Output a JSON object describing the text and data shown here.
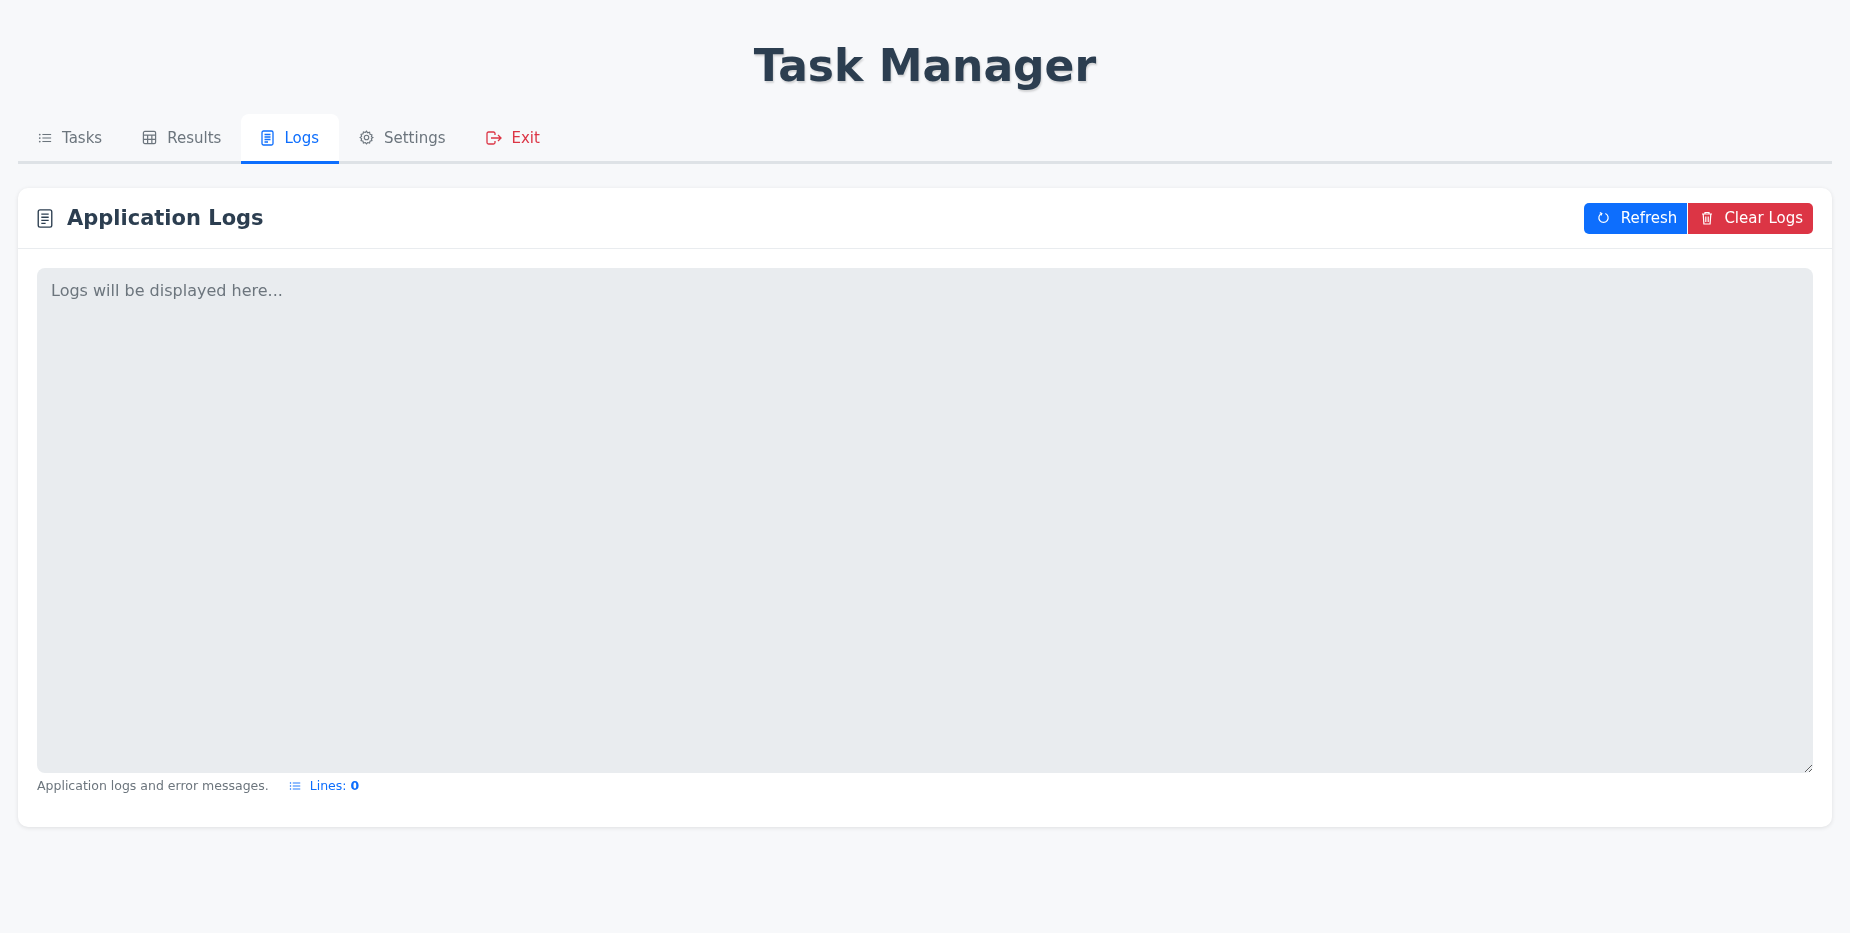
{
  "title": "Task Manager",
  "tabs": [
    {
      "label": "Tasks",
      "kind": "list",
      "selected": false
    },
    {
      "label": "Results",
      "kind": "table",
      "selected": false
    },
    {
      "label": "Logs",
      "kind": "document",
      "selected": true
    },
    {
      "label": "Settings",
      "kind": "gear",
      "selected": false
    },
    {
      "label": "Exit",
      "kind": "exit",
      "selected": false
    }
  ],
  "card": {
    "title": "Application Logs",
    "buttons": [
      {
        "label": "Refresh",
        "kind": "refresh"
      },
      {
        "label": "Clear Logs",
        "kind": "clear"
      }
    ],
    "log_field": {
      "placeholder": "Logs will be displayed here..."
    },
    "help_text": "Application logs and error messages.",
    "line_count": "Lines: **0**"
  }
}
